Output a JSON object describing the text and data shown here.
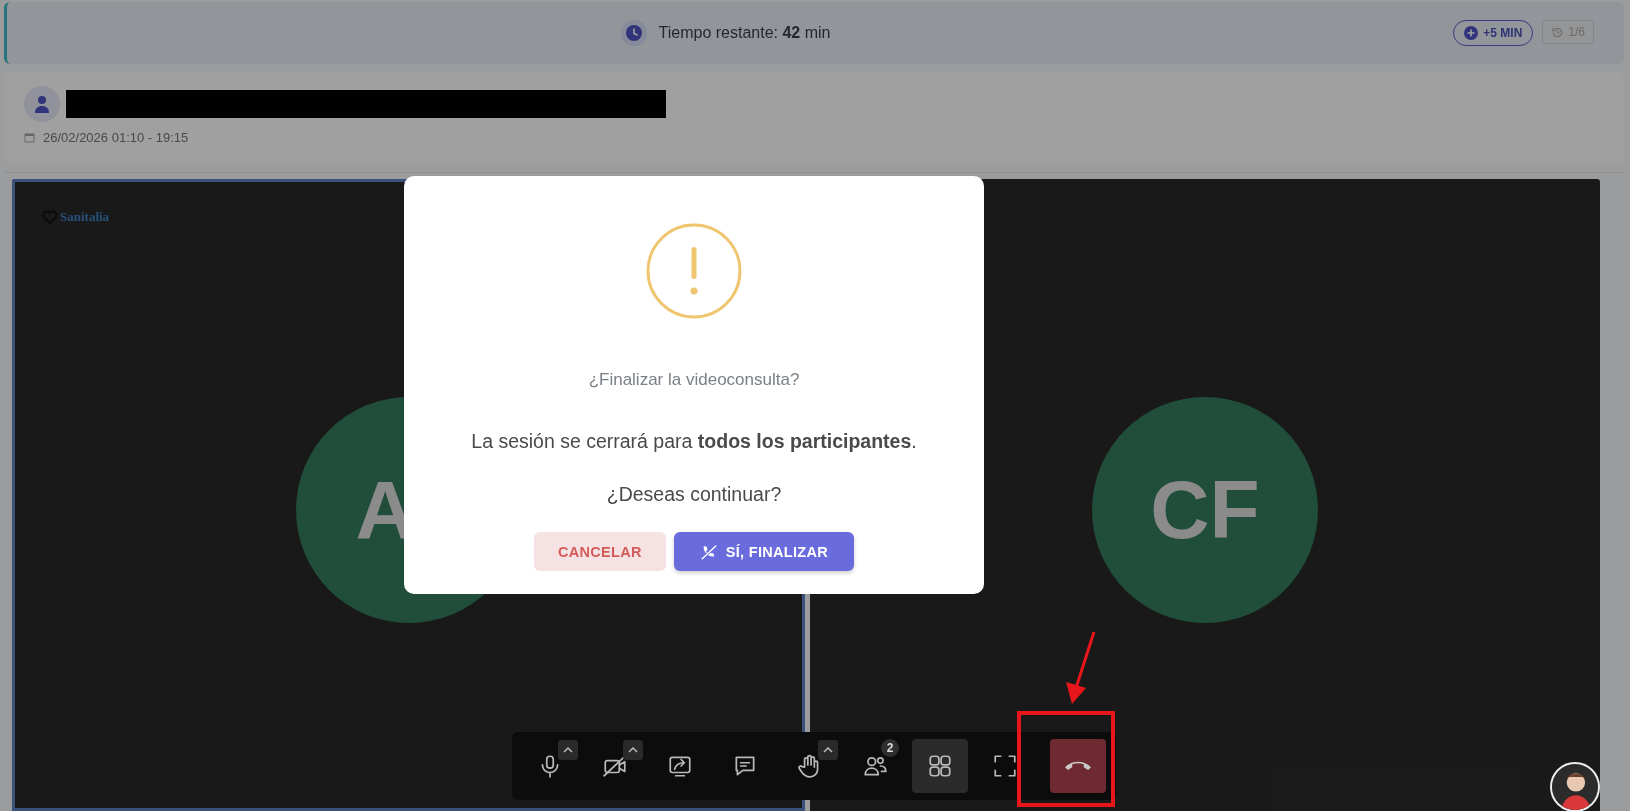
{
  "timer": {
    "text": "Tiempo restante: **42** min",
    "add_button": "+5 MIN",
    "counter": {
      "label": "1/6",
      "disabled": true
    }
  },
  "header": {
    "name_redacted": true,
    "date": "26/02/2026 01:10 - 19:15"
  },
  "tiles": [
    {
      "initials": "A",
      "logo": "Sanitalia",
      "highlighted": true
    },
    {
      "initials": "CF",
      "highlighted": false
    }
  ],
  "toolbar": [
    {
      "kind": "mic",
      "caret": true,
      "selected": false
    },
    {
      "kind": "camera-off",
      "caret": true,
      "selected": false
    },
    {
      "kind": "share",
      "caret": false,
      "selected": false
    },
    {
      "kind": "chat",
      "caret": false,
      "selected": false
    },
    {
      "kind": "hand",
      "caret": true,
      "selected": false
    },
    {
      "kind": "people",
      "caret": false,
      "badge": "2",
      "selected": false
    },
    {
      "kind": "grid",
      "caret": false,
      "selected": true
    },
    {
      "kind": "fullscreen",
      "caret": false,
      "selected": false
    },
    {
      "kind": "hangup",
      "caret": false,
      "selected": false
    }
  ],
  "dialog": {
    "title": "¿Finalizar la videoconsulta?",
    "message": "La sesión se cerrará para **todos los participantes**.",
    "question": "¿Deseas continuar?",
    "cancel": "CANCELAR",
    "confirm": "SÍ, FINALIZAR"
  },
  "annotation": {
    "highlight_box": true,
    "arrow": true
  }
}
